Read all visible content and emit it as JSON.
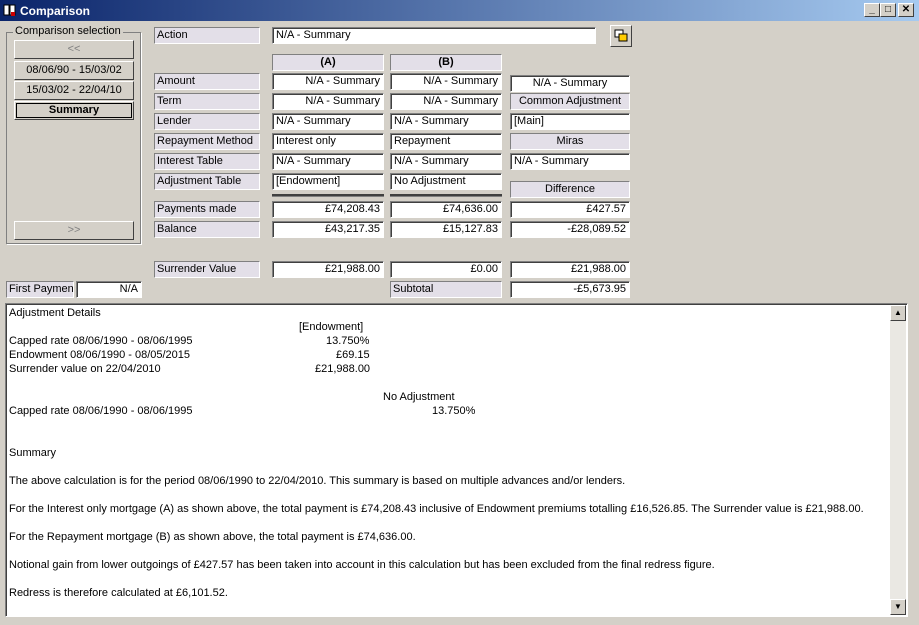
{
  "window": {
    "title": "Comparison"
  },
  "selection": {
    "legend": "Comparison selection",
    "prev": "<<",
    "next": ">>",
    "items": [
      "08/06/90 - 15/03/02",
      "15/03/02 - 22/04/10",
      "Summary"
    ]
  },
  "action": {
    "label": "Action",
    "value": "N/A - Summary"
  },
  "columns": {
    "a": "(A)",
    "b": "(B)"
  },
  "rows": {
    "amount": {
      "label": "Amount",
      "a": "N/A - Summary",
      "b": "N/A - Summary",
      "c": "N/A - Summary"
    },
    "term": {
      "label": "Term",
      "a": "N/A - Summary",
      "b": "N/A - Summary",
      "c": "Common Adjustment"
    },
    "lender": {
      "label": "Lender",
      "a": "N/A - Summary",
      "b": "N/A - Summary",
      "c": "[Main]"
    },
    "repayment": {
      "label": "Repayment Method",
      "a": "Interest only",
      "b": "Repayment",
      "c": "Miras"
    },
    "interest": {
      "label": "Interest Table",
      "a": "N/A - Summary",
      "b": "N/A - Summary",
      "c": "N/A - Summary"
    },
    "adjustment": {
      "label": "Adjustment Table",
      "a": "[Endowment]",
      "b": "No Adjustment"
    },
    "difference_header": "Difference",
    "payments": {
      "label": "Payments made",
      "a": "£74,208.43",
      "b": "£74,636.00",
      "c": "£427.57"
    },
    "balance": {
      "label": "Balance",
      "a": "£43,217.35",
      "b": "£15,127.83",
      "c": "-£28,089.52"
    },
    "surrender": {
      "label": "Surrender Value",
      "a": "£21,988.00",
      "b": "£0.00",
      "c": "£21,988.00"
    },
    "subtotal": {
      "label": "Subtotal",
      "c": "-£5,673.95"
    }
  },
  "first_payment": {
    "label": "First Payment",
    "value": "N/A"
  },
  "details": {
    "heading": "Adjustment Details",
    "endowment_header": "[Endowment]",
    "capped1_label": "Capped rate 08/06/1990 - 08/06/1995",
    "capped1_value": "13.750%",
    "endowment_label": "Endowment 08/06/1990 - 08/05/2015",
    "endowment_value": "£69.15",
    "surrender_label": "Surrender value on 22/04/2010",
    "surrender_value": "£21,988.00",
    "noadj_header": "No Adjustment",
    "capped2_label": "Capped rate 08/06/1990 - 08/06/1995",
    "capped2_value": "13.750%",
    "summary_heading": "Summary",
    "p1": "The above calculation is for the period 08/06/1990 to 22/04/2010. This summary is based on multiple advances and/or lenders.",
    "p2": "For the Interest only mortgage (A) as shown above, the total payment is £74,208.43 inclusive of Endowment premiums totalling £16,526.85. The Surrender value is £21,988.00.",
    "p3": "For the Repayment mortgage (B) as shown above, the total payment is £74,636.00.",
    "p4": "Notional gain from lower outgoings of £427.57 has been taken into account in this calculation but has been excluded from the final redress figure.",
    "p5": "Redress is therefore calculated at £6,101.52."
  }
}
